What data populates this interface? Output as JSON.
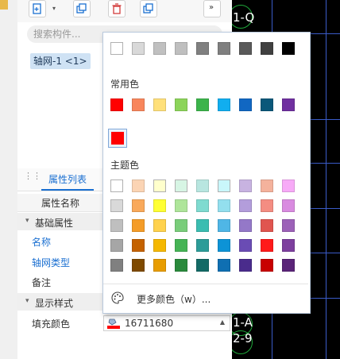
{
  "search": {
    "placeholder": "搜索构件..."
  },
  "tree": {
    "selected_item": "轴网-1 <1>"
  },
  "property_panel": {
    "tab_label": "属性列表",
    "header_name_col": "属性名称",
    "groups": [
      {
        "label": "基础属性",
        "rows": [
          {
            "key": "名称"
          },
          {
            "key": "轴网类型"
          },
          {
            "key": "备注"
          }
        ]
      },
      {
        "label": "显示样式",
        "rows": [
          {
            "key": "填充颜色",
            "value": "16711680"
          }
        ]
      }
    ]
  },
  "cad": {
    "labels": [
      "1-Q",
      "1-A",
      "2-9"
    ]
  },
  "color_picker": {
    "top_row": [
      "#ffffff",
      "#d9d9d9",
      "#c0c0c0",
      "#bfbfbf",
      "#808080",
      "#7f7f7f",
      "#595959",
      "#404040",
      "#000000"
    ],
    "common_title": "常用色",
    "common_colors": [
      "#ff0000",
      "#f8865c",
      "#ffe07a",
      "#8cd45a",
      "#3cb44b",
      "#11aeef",
      "#1167c2",
      "#0b587a",
      "#7030a0"
    ],
    "selected_color": "#ff0000",
    "theme_title": "主题色",
    "theme_colors": [
      [
        "#ffffff",
        "#fbd4b4",
        "#ffffcc",
        "#d7f5e4",
        "#b8e6e0",
        "#c9f7fb",
        "#c8b3e1",
        "#f4b29c",
        "#f7aaf7"
      ],
      [
        "#d9d9d9",
        "#f9a95b",
        "#ffff33",
        "#aee59a",
        "#7fdbd0",
        "#93dfee",
        "#b39ddb",
        "#f48d82",
        "#d98be0"
      ],
      [
        "#bfbfbf",
        "#f49c28",
        "#ffd24d",
        "#79cd7a",
        "#3bbdb1",
        "#4fb6e6",
        "#9478c8",
        "#e0554f",
        "#9c61b8"
      ],
      [
        "#a6a6a6",
        "#c46200",
        "#f5b800",
        "#45b455",
        "#2c9c98",
        "#0d93d6",
        "#6a4cb4",
        "#ff1a1a",
        "#7d3f9e"
      ],
      [
        "#808080",
        "#7f4a00",
        "#e89d00",
        "#2a8a3c",
        "#136a66",
        "#0f6fb2",
        "#4a2c8c",
        "#c80000",
        "#5a2478"
      ]
    ],
    "more_label": "更多颜色（w）..."
  }
}
